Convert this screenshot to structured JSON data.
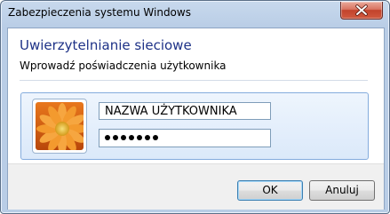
{
  "window": {
    "title": "Zabezpieczenia systemu Windows"
  },
  "dialog": {
    "heading": "Uwierzytelnianie sieciowe",
    "subheading": "Wprowadź poświadczenia użytkownika"
  },
  "credentials": {
    "username_value": "NAZWA UŻYTKOWNIKA",
    "password_length": 7,
    "avatar_icon": "flower-avatar-icon"
  },
  "buttons": {
    "ok_label": "OK",
    "cancel_label": "Anuluj"
  },
  "colors": {
    "heading": "#1e3287",
    "frame": "#b9cde6",
    "close_button": "#c2432c"
  }
}
